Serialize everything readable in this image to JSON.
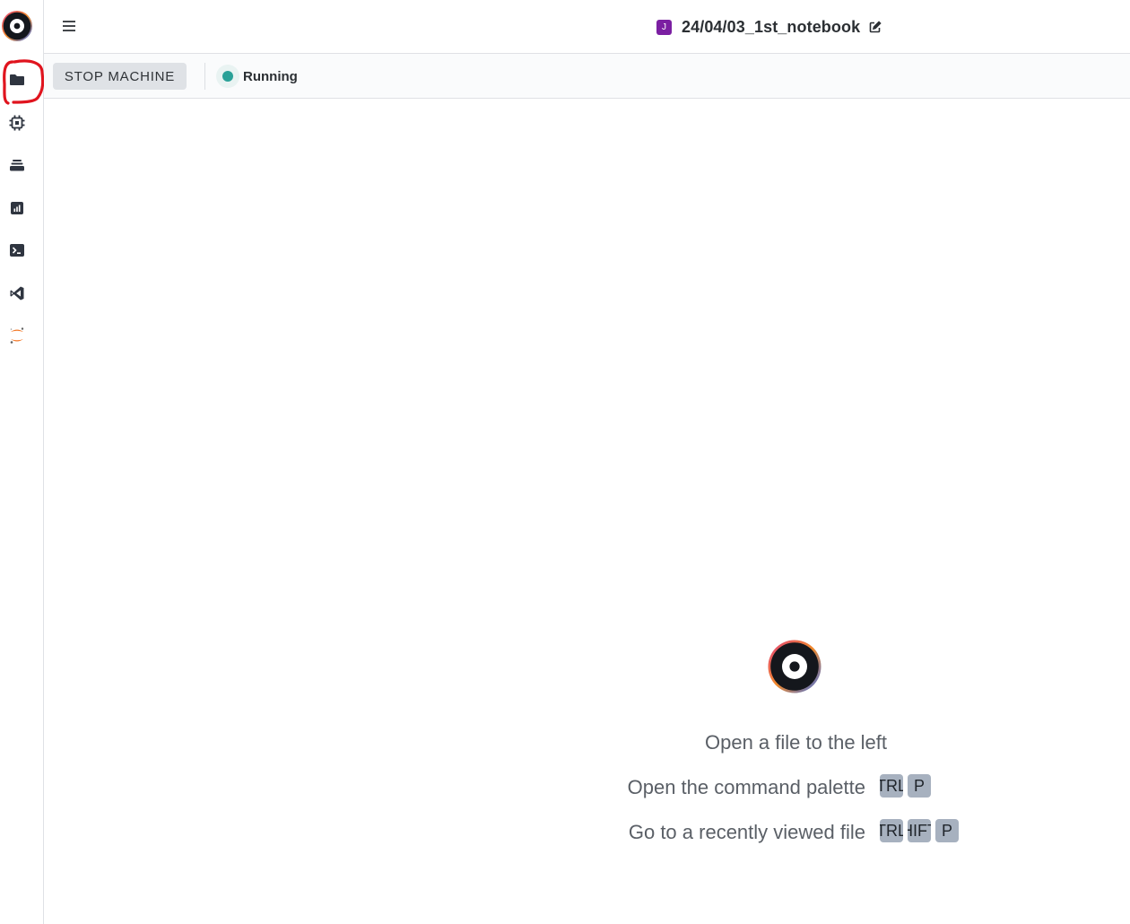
{
  "notebook": {
    "badge": "J",
    "title": "24/04/03_1st_notebook"
  },
  "toolbar": {
    "stop_label": "STOP MACHINE",
    "status_label": "Running",
    "status_color": "#2aa198"
  },
  "sidebar": {
    "items": [
      {
        "icon": "folder-icon"
      },
      {
        "icon": "cpu-icon"
      },
      {
        "icon": "layers-icon"
      },
      {
        "icon": "chart-icon"
      },
      {
        "icon": "terminal-icon"
      },
      {
        "icon": "vscode-icon"
      },
      {
        "icon": "jupyter-icon"
      }
    ]
  },
  "empty_state": {
    "line1": "Open a file to the left",
    "line2": "Open the command palette",
    "line2_keys": [
      "TRL",
      "P"
    ],
    "line3": "Go to a recently viewed file",
    "line3_keys": [
      "TRL",
      "HIFT",
      "P"
    ]
  },
  "colors": {
    "accent_purple": "#7b1fa2",
    "annotation_red": "#e0141e"
  }
}
